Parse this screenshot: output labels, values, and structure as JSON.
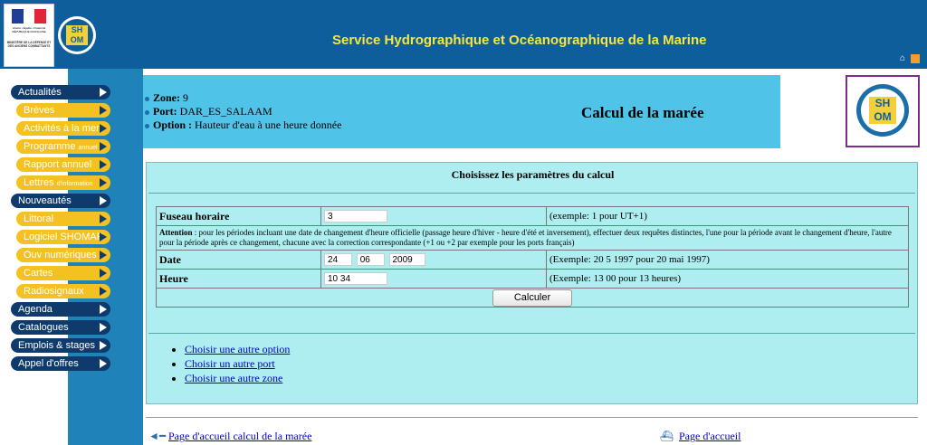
{
  "header": {
    "site_title": "Service Hydrographique et Océanographique de la Marine",
    "logo_rf": {
      "motto": "Liberté • Égalité • Fraternité",
      "republic": "RÉPUBLIQUE FRANÇAISE",
      "ministry": "MINISTÈRE DE LA DÉFENSE ET DES ANCIENS COMBATTANTS"
    },
    "shom_logo": {
      "line1": "SH",
      "line2": "OM"
    }
  },
  "sidebar": {
    "items": [
      {
        "label": "Actualités",
        "kind": "main"
      },
      {
        "label": "Brèves",
        "kind": "sub"
      },
      {
        "label": "Activités à la mer",
        "kind": "sub"
      },
      {
        "label": "Programme",
        "suffix": "annuel",
        "kind": "sub"
      },
      {
        "label": "Rapport annuel",
        "kind": "sub"
      },
      {
        "label": "Lettres",
        "suffix": "d'information",
        "kind": "sub"
      },
      {
        "label": "Nouveautés",
        "kind": "main"
      },
      {
        "label": "Littoral",
        "kind": "sub"
      },
      {
        "label": "Logiciel SHOMAR",
        "kind": "sub"
      },
      {
        "label": "Ouv numériques",
        "kind": "sub"
      },
      {
        "label": "Cartes",
        "kind": "sub"
      },
      {
        "label": "Radiosignaux",
        "kind": "sub"
      },
      {
        "label": "Agenda",
        "kind": "main"
      },
      {
        "label": "Catalogues",
        "kind": "main"
      },
      {
        "label": "Emplois & stages",
        "kind": "main"
      },
      {
        "label": "Appel d'offres",
        "kind": "main"
      }
    ]
  },
  "info": {
    "zone_label": "Zone:",
    "zone_value": "9",
    "port_label": "Port:",
    "port_value": "DAR_ES_SALAAM",
    "option_label": "Option :",
    "option_value": "Hauteur d'eau à une heure donnée",
    "title": "Calcul de la marée"
  },
  "calc": {
    "heading": "Choisissez les paramètres du calcul",
    "fuseau_label": "Fuseau horaire",
    "fuseau_value": "3",
    "fuseau_hint": "(exemple: 1 pour UT+1)",
    "attention_bold": "Attention",
    "attention_text": " : pour les périodes incluant une date de changement d'heure officielle (passage heure d'hiver - heure d'été et inversement), effectuer deux requêtes distinctes, l'une pour la période avant le changement d'heure, l'autre pour la période après ce changement, chacune avec la correction correspondante (+1 ou +2 par exemple pour les ports français)",
    "date_label": "Date",
    "date_day": "24",
    "date_month": "06",
    "date_year": "2009",
    "date_hint": "(Exemple: 20 5 1997 pour 20 mai 1997)",
    "heure_label": "Heure",
    "heure_value": "10 34",
    "heure_hint": "(Exemple: 13 00 pour 13 heures)",
    "button": "Calculer"
  },
  "links": [
    "Choisir une autre option",
    "Choisir un autre port",
    "Choisir une autre zone"
  ],
  "footer": {
    "left_link": "Page d'accueil calcul de la marée",
    "right_link": "Page d'accueil"
  },
  "colors": {
    "header": "#0f5e9c",
    "accent_yellow": "#f5e640",
    "menu_main": "#0e3b6c",
    "menu_sub": "#f3c220",
    "panel": "#aeeef0",
    "zone_box": "#4fc3e8"
  }
}
